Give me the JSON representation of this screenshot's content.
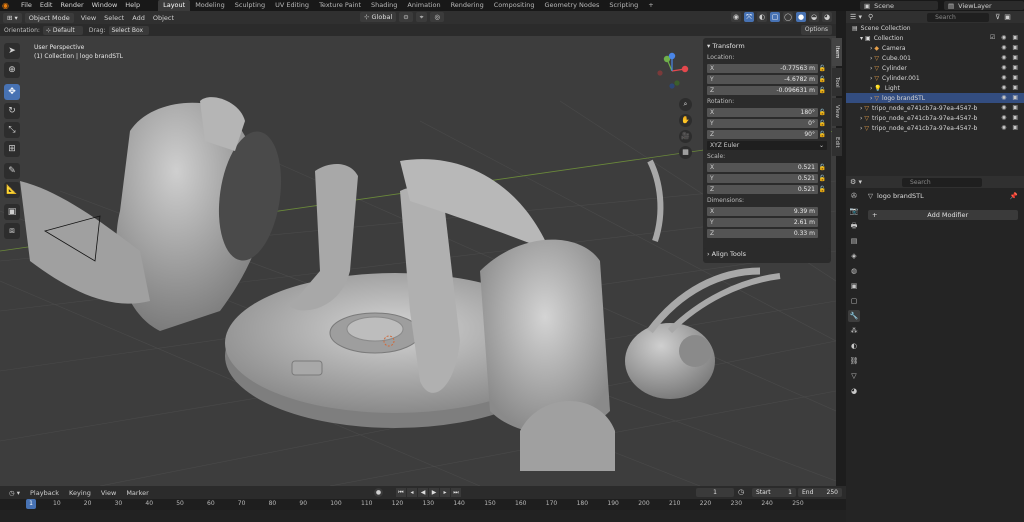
{
  "menu": [
    "File",
    "Edit",
    "Render",
    "Window",
    "Help"
  ],
  "workspaces": [
    {
      "label": "Layout",
      "active": true
    },
    {
      "label": "Modeling"
    },
    {
      "label": "Sculpting"
    },
    {
      "label": "UV Editing"
    },
    {
      "label": "Texture Paint"
    },
    {
      "label": "Shading"
    },
    {
      "label": "Animation"
    },
    {
      "label": "Rendering"
    },
    {
      "label": "Compositing"
    },
    {
      "label": "Geometry Nodes"
    },
    {
      "label": "Scripting"
    }
  ],
  "scene_name": "Scene",
  "view_layer": "ViewLayer",
  "viewport": {
    "mode": "Object Mode",
    "menus": [
      "View",
      "Select",
      "Add",
      "Object"
    ],
    "transform_orientation": "Global",
    "orientation_label": "Orientation:",
    "orientation_value": "Default",
    "drag_label": "Drag:",
    "drag_value": "Select Box",
    "options_label": "Options",
    "info_line1": "User Perspective",
    "info_line2": "(1) Collection | logo brandSTL"
  },
  "npanel": {
    "title": "Transform",
    "location_label": "Location:",
    "location": [
      {
        "axis": "X",
        "value": "-0.77563 m"
      },
      {
        "axis": "Y",
        "value": "-4.6782 m"
      },
      {
        "axis": "Z",
        "value": "-0.096631 m"
      }
    ],
    "rotation_label": "Rotation:",
    "rotation": [
      {
        "axis": "X",
        "value": "180°"
      },
      {
        "axis": "Y",
        "value": "0°"
      },
      {
        "axis": "Z",
        "value": "90°"
      }
    ],
    "rotation_mode": "XYZ Euler",
    "scale_label": "Scale:",
    "scale": [
      {
        "axis": "X",
        "value": "0.521"
      },
      {
        "axis": "Y",
        "value": "0.521"
      },
      {
        "axis": "Z",
        "value": "0.521"
      }
    ],
    "dimensions_label": "Dimensions:",
    "dimensions": [
      {
        "axis": "X",
        "value": "9.39 m"
      },
      {
        "axis": "Y",
        "value": "2.61 m"
      },
      {
        "axis": "Z",
        "value": "0.33 m"
      }
    ],
    "align_tools": "Align Tools",
    "side_tabs": [
      "Item",
      "Tool",
      "View",
      "Edit"
    ]
  },
  "timeline": {
    "menus": [
      "Playback",
      "Keying",
      "View",
      "Marker"
    ],
    "current_frame": "1",
    "start_label": "Start",
    "start": "1",
    "end_label": "End",
    "end": "250",
    "ticks": [
      "1",
      "10",
      "20",
      "30",
      "40",
      "50",
      "60",
      "70",
      "80",
      "90",
      "100",
      "110",
      "120",
      "130",
      "140",
      "150",
      "160",
      "170",
      "180",
      "190",
      "200",
      "210",
      "220",
      "230",
      "240",
      "250"
    ]
  },
  "outliner": {
    "search_placeholder": "Search",
    "root": "Scene Collection",
    "collection": "Collection",
    "items": [
      {
        "label": "Camera",
        "icon": "camera-icon"
      },
      {
        "label": "Cube.001",
        "icon": "mesh-icon"
      },
      {
        "label": "Cylinder",
        "icon": "mesh-icon"
      },
      {
        "label": "Cylinder.001",
        "icon": "mesh-icon"
      },
      {
        "label": "Light",
        "icon": "light-icon"
      },
      {
        "label": "logo brandSTL",
        "icon": "mesh-icon",
        "selected": true
      }
    ],
    "extra_items": [
      {
        "label": "tripo_node_e741cb7a-97ea-4547-b"
      },
      {
        "label": "tripo_node_e741cb7a-97ea-4547-b"
      },
      {
        "label": "tripo_node_e741cb7a-97ea-4547-b"
      }
    ]
  },
  "properties": {
    "search_placeholder": "Search",
    "object_name": "logo brandSTL",
    "add_modifier": "Add Modifier"
  },
  "colors": {
    "accent": "#4772b3",
    "selected_row": "#334d80",
    "mesh_orange": "#e8a04a",
    "vis_green": "#5bbf60"
  }
}
